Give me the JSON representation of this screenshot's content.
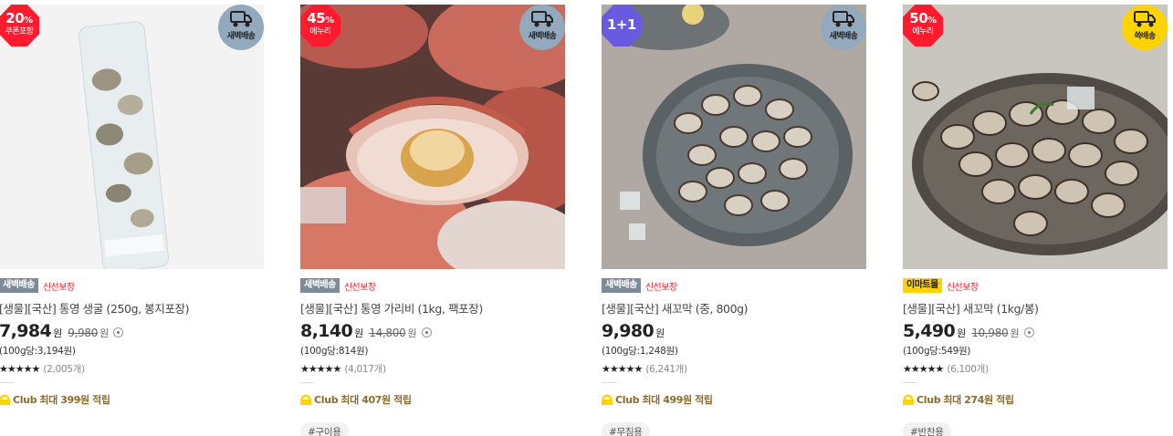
{
  "colors": {
    "discount_red": "#ff1a2e",
    "plus_purple": "#6a5ae0",
    "delivery_gray": "#93a9bd",
    "delivery_yellow": "#ffd400",
    "club_brown": "#8c6c2c"
  },
  "products": [
    {
      "badge": {
        "pct": "20",
        "pct_unit": "%",
        "sub": "쿠폰포함",
        "style": "red"
      },
      "delivery": {
        "label": "새벽배송",
        "style": "gray",
        "icon": "truck-icon"
      },
      "tag": {
        "label": "새벽배송",
        "style": "gray"
      },
      "fresh": "신선보장",
      "name": "[생물][국산] 통영 생굴 (250g, 봉지포장)",
      "price": "7,984",
      "won": "원",
      "orig_price": "9,980",
      "orig_won": "원",
      "unit_price": "(100g당:3,194원)",
      "stars": "★★★★★",
      "reviews": "(2,005개)",
      "club_label": "Club",
      "club_text": "최대 399원 적립",
      "hashtag": ""
    },
    {
      "badge": {
        "pct": "45",
        "pct_unit": "%",
        "sub": "에누리",
        "style": "red"
      },
      "delivery": {
        "label": "새벽배송",
        "style": "gray",
        "icon": "truck-icon"
      },
      "tag": {
        "label": "새벽배송",
        "style": "gray"
      },
      "fresh": "신선보장",
      "name": "[생물][국산] 통영 가리비 (1kg, 팩포장)",
      "price": "8,140",
      "won": "원",
      "orig_price": "14,800",
      "orig_won": "원",
      "unit_price": "(100g당:814원)",
      "stars": "★★★★★",
      "reviews": "(4,017개)",
      "club_label": "Club",
      "club_text": "최대 407원 적립",
      "hashtag": "#구이용"
    },
    {
      "badge": {
        "pct": "1+1",
        "pct_unit": "",
        "sub": "",
        "style": "purple"
      },
      "delivery": {
        "label": "새벽배송",
        "style": "gray",
        "icon": "truck-icon"
      },
      "tag": {
        "label": "새벽배송",
        "style": "gray"
      },
      "fresh": "신선보장",
      "name": "[생물][국산] 새꼬막 (중, 800g)",
      "price": "9,980",
      "won": "원",
      "orig_price": "",
      "orig_won": "",
      "unit_price": "(100g당:1,248원)",
      "stars": "★★★★★",
      "reviews": "(6,241개)",
      "club_label": "Club",
      "club_text": "최대 499원 적립",
      "hashtag": "#무침용"
    },
    {
      "badge": {
        "pct": "50",
        "pct_unit": "%",
        "sub": "에누리",
        "style": "red"
      },
      "delivery": {
        "label": "쓱배송",
        "style": "yellow",
        "icon": "truck-icon"
      },
      "tag": {
        "label": "이마트몰",
        "style": "yellow"
      },
      "fresh": "신선보장",
      "name": "[생물][국산] 새꼬막 (1kg/봉)",
      "price": "5,490",
      "won": "원",
      "orig_price": "10,980",
      "orig_won": "원",
      "unit_price": "(100g당:549원)",
      "stars": "★★★★★",
      "reviews": "(6,100개)",
      "club_label": "Club",
      "club_text": "최대 274원 적립",
      "hashtag": "#반찬용"
    }
  ]
}
